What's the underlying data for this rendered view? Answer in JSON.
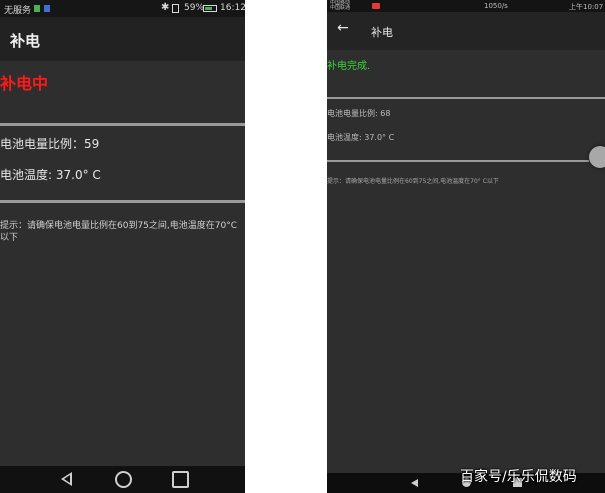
{
  "left": {
    "status": {
      "carrier": "无服务",
      "battery_pct": "59%",
      "battery_level": 0.59,
      "time": "16:12"
    },
    "appbar": {
      "title": "补电"
    },
    "state_text": "补电中",
    "battery_line": "电池电量比例：59",
    "temp_line": "电池温度: 37.0° C",
    "tip": "提示：请确保电池电量比例在60到75之间,电池温度在70°C以下",
    "state_color": "#ff1a1a"
  },
  "right": {
    "status": {
      "carrier_line1": "中国移动",
      "carrier_line2": "中国联通",
      "info": "1050/s",
      "time": "上午10:07"
    },
    "appbar": {
      "back_icon": "back-arrow-icon",
      "title": "补电"
    },
    "state_text": "补电完成.",
    "battery_line": "电池电量比例: 68",
    "temp_line": "电池温度: 37.0° C",
    "tip": "提示：请确保电池电量比例在60到75之间,电池温度在70° C以下",
    "state_color": "#39d439"
  },
  "watermark": "百家号/乐乐侃数码"
}
